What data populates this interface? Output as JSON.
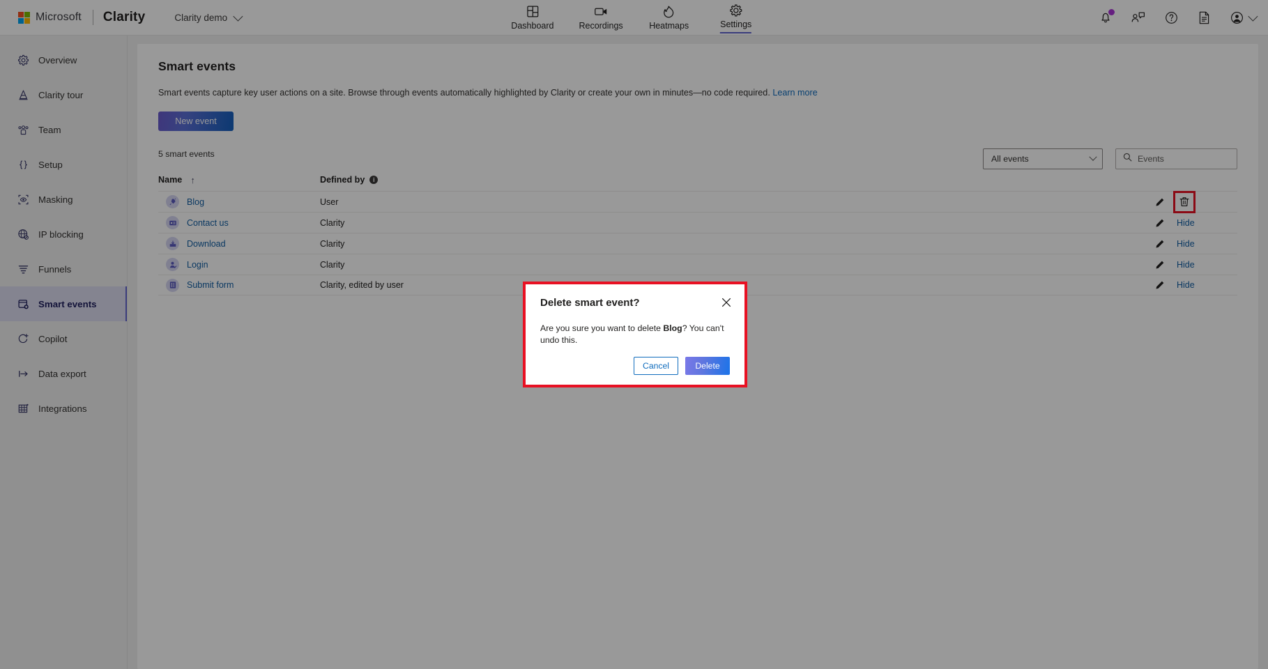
{
  "header": {
    "brand_microsoft": "Microsoft",
    "brand_product": "Clarity",
    "project_name": "Clarity demo",
    "nav_tabs": [
      {
        "label": "Dashboard",
        "icon": "dashboard-icon",
        "active": false
      },
      {
        "label": "Recordings",
        "icon": "video-camera-icon",
        "active": false
      },
      {
        "label": "Heatmaps",
        "icon": "flame-icon",
        "active": false
      },
      {
        "label": "Settings",
        "icon": "gear-icon",
        "active": true
      }
    ],
    "right_icons": [
      {
        "name": "notifications-bell-icon",
        "badge": true
      },
      {
        "name": "feedback-people-icon",
        "badge": false
      },
      {
        "name": "help-question-icon",
        "badge": false
      },
      {
        "name": "documentation-page-icon",
        "badge": false
      },
      {
        "name": "account-avatar-icon",
        "badge": false
      }
    ]
  },
  "sidebar": {
    "items": [
      {
        "label": "Overview",
        "icon": "gear-overview-icon",
        "active": false
      },
      {
        "label": "Clarity tour",
        "icon": "tour-cone-icon",
        "active": false
      },
      {
        "label": "Team",
        "icon": "team-people-icon",
        "active": false
      },
      {
        "label": "Setup",
        "icon": "code-braces-icon",
        "active": false
      },
      {
        "label": "Masking",
        "icon": "masking-eye-icon",
        "active": false
      },
      {
        "label": "IP blocking",
        "icon": "globe-block-icon",
        "active": false
      },
      {
        "label": "Funnels",
        "icon": "funnel-icon",
        "active": false
      },
      {
        "label": "Smart events",
        "icon": "smart-events-icon",
        "active": true
      },
      {
        "label": "Copilot",
        "icon": "copilot-sparkle-icon",
        "active": false
      },
      {
        "label": "Data export",
        "icon": "data-export-arrow-icon",
        "active": false
      },
      {
        "label": "Integrations",
        "icon": "integrations-grid-icon",
        "active": false
      }
    ]
  },
  "main": {
    "title": "Smart events",
    "description": "Smart events capture key user actions on a site. Browse through events automatically highlighted by Clarity or create your own in minutes—no code required.",
    "learn_more": "Learn more",
    "new_event_button": "New event",
    "count_label": "5 smart events",
    "filter_select": {
      "value": "All events",
      "options": [
        "All events"
      ]
    },
    "search": {
      "value": "",
      "placeholder": "Events"
    },
    "table": {
      "columns": [
        "Name",
        "Defined by"
      ],
      "sort_indicator": "↑",
      "rows": [
        {
          "name": "Blog",
          "defined_by": "User",
          "icon": "plug-event-icon",
          "action": "delete",
          "action_label": ""
        },
        {
          "name": "Contact us",
          "defined_by": "Clarity",
          "icon": "contact-card-icon",
          "action": "hide",
          "action_label": "Hide"
        },
        {
          "name": "Download",
          "defined_by": "Clarity",
          "icon": "download-box-icon",
          "action": "hide",
          "action_label": "Hide"
        },
        {
          "name": "Login",
          "defined_by": "Clarity",
          "icon": "login-person-icon",
          "action": "hide",
          "action_label": "Hide"
        },
        {
          "name": "Submit form",
          "defined_by": "Clarity, edited by user",
          "icon": "form-list-icon",
          "action": "hide",
          "action_label": "Hide"
        }
      ]
    }
  },
  "modal": {
    "title": "Delete smart event?",
    "body_prefix": "Are you sure you want to delete ",
    "body_target": "Blog",
    "body_suffix": "? You can't undo this.",
    "cancel_label": "Cancel",
    "delete_label": "Delete",
    "close_icon": "close-x-icon"
  },
  "colors": {
    "accent_purple": "#6264cf",
    "link_blue": "#115ea3",
    "highlight_red": "#e81123",
    "badge_purple": "#a933d6",
    "button_gradient_from": "#6a5acd",
    "button_gradient_to": "#1560bd"
  }
}
